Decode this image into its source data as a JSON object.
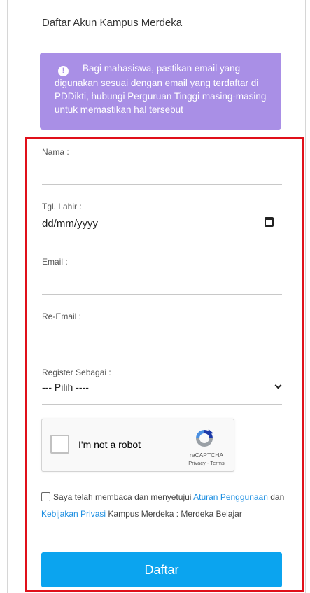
{
  "page": {
    "title": "Daftar Akun Kampus Merdeka"
  },
  "alert": {
    "icon": "exclamation-icon",
    "color": "#a98fe6",
    "line1": "Bagi mahasiswa, pastikan email yang",
    "line2": "digunakan sesuai dengan email yang terdaftar di",
    "line3": "PDDikti, hubungi Perguruan Tinggi masing-masing",
    "line4": "untuk memastikan hal tersebut"
  },
  "form": {
    "highlight_color": "#e0101a",
    "nama": {
      "label": "Nama :",
      "value": ""
    },
    "tgl_lahir": {
      "label": "Tgl. Lahir :",
      "value": "dd/mm/yyyy",
      "icon": "calendar-icon"
    },
    "email": {
      "label": "Email :",
      "value": ""
    },
    "re_email": {
      "label": "Re-Email :",
      "value": ""
    },
    "register": {
      "label": "Register Sebagai :",
      "selected": "--- Pilih ----",
      "icon": "chevron-down-icon"
    },
    "recaptcha": {
      "label": "I'm not a robot",
      "brand": "reCAPTCHA",
      "links": "Privacy - Terms",
      "checked": false
    },
    "agreement": {
      "checked": false,
      "text1": "Saya telah membaca dan menyetujui",
      "link1": "Aturan Penggunaan",
      "text2": "dan",
      "link2": "Kebijakan Privasi",
      "text3": "Kampus Merdeka : Merdeka Belajar"
    },
    "submit": {
      "label": "Daftar",
      "color": "#0ba4ef"
    }
  }
}
